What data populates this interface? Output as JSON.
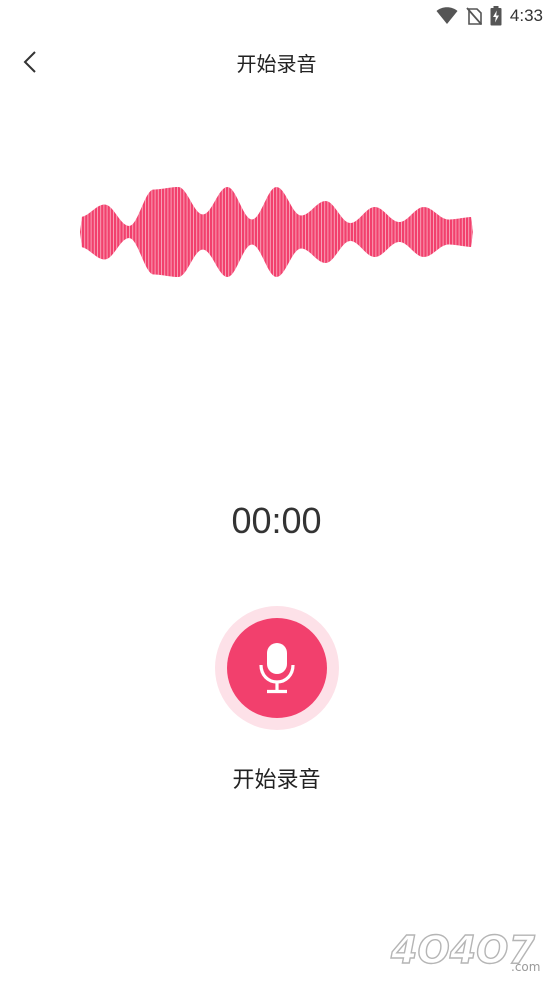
{
  "status_bar": {
    "time": "4:33"
  },
  "header": {
    "title": "开始录音",
    "back_icon": "chevron-left-icon"
  },
  "waveform": {
    "color": "#f2406d",
    "amplitudes": [
      0.3,
      0.55,
      0.12,
      0.85,
      0.9,
      0.35,
      0.9,
      0.25,
      0.9,
      0.33,
      0.62,
      0.18,
      0.5,
      0.2,
      0.5,
      0.25,
      0.3
    ]
  },
  "timer": {
    "value": "00:00"
  },
  "record_button": {
    "label": "开始录音",
    "icon": "microphone-icon",
    "color": "#f2406d",
    "halo_color": "#fde1e8"
  },
  "watermark": {
    "text": "4O4O7",
    "suffix": ".com"
  }
}
